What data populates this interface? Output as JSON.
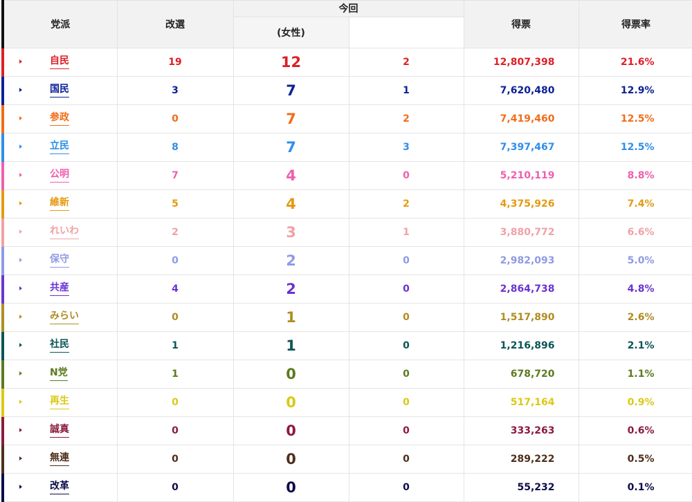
{
  "header": {
    "party": "党派",
    "kaisen": "改選",
    "konkai": "今回",
    "female": "(女性)",
    "votes": "得票",
    "rate": "得票率"
  },
  "rows": [
    {
      "party": "自民",
      "color": "#dd1f26",
      "kaisen": "19",
      "konkai": "12",
      "female": "2",
      "votes": "12,807,398",
      "rate": "21.6%"
    },
    {
      "party": "国民",
      "color": "#0b2196",
      "kaisen": "3",
      "konkai": "7",
      "female": "1",
      "votes": "7,620,480",
      "rate": "12.9%"
    },
    {
      "party": "参政",
      "color": "#f06d1a",
      "kaisen": "0",
      "konkai": "7",
      "female": "2",
      "votes": "7,419,460",
      "rate": "12.5%"
    },
    {
      "party": "立民",
      "color": "#2f8ee8",
      "kaisen": "8",
      "konkai": "7",
      "female": "3",
      "votes": "7,397,467",
      "rate": "12.5%"
    },
    {
      "party": "公明",
      "color": "#ee5fae",
      "kaisen": "7",
      "konkai": "4",
      "female": "0",
      "votes": "5,210,119",
      "rate": "8.8%"
    },
    {
      "party": "維新",
      "color": "#e49a10",
      "kaisen": "5",
      "konkai": "4",
      "female": "2",
      "votes": "4,375,926",
      "rate": "7.4%"
    },
    {
      "party": "れいわ",
      "color": "#f0a1a6",
      "kaisen": "2",
      "konkai": "3",
      "female": "1",
      "votes": "3,880,772",
      "rate": "6.6%"
    },
    {
      "party": "保守",
      "color": "#8f9ae6",
      "kaisen": "0",
      "konkai": "2",
      "female": "0",
      "votes": "2,982,093",
      "rate": "5.0%"
    },
    {
      "party": "共産",
      "color": "#6a33d0",
      "kaisen": "4",
      "konkai": "2",
      "female": "0",
      "votes": "2,864,738",
      "rate": "4.8%"
    },
    {
      "party": "みらい",
      "color": "#b08c23",
      "kaisen": "0",
      "konkai": "1",
      "female": "0",
      "votes": "1,517,890",
      "rate": "2.6%"
    },
    {
      "party": "社民",
      "color": "#0a5554",
      "kaisen": "1",
      "konkai": "1",
      "female": "0",
      "votes": "1,216,896",
      "rate": "2.1%"
    },
    {
      "party": "N党",
      "color": "#5c7a1f",
      "kaisen": "1",
      "konkai": "0",
      "female": "0",
      "votes": "678,720",
      "rate": "1.1%"
    },
    {
      "party": "再生",
      "color": "#dcc816",
      "kaisen": "0",
      "konkai": "0",
      "female": "0",
      "votes": "517,164",
      "rate": "0.9%"
    },
    {
      "party": "誠真",
      "color": "#8b1b3c",
      "kaisen": "0",
      "konkai": "0",
      "female": "0",
      "votes": "333,263",
      "rate": "0.6%"
    },
    {
      "party": "無連",
      "color": "#4e2e1a",
      "kaisen": "0",
      "konkai": "0",
      "female": "0",
      "votes": "289,222",
      "rate": "0.5%"
    },
    {
      "party": "改革",
      "color": "#0c0c4a",
      "kaisen": "0",
      "konkai": "0",
      "female": "0",
      "votes": "55,232",
      "rate": "0.1%"
    }
  ]
}
